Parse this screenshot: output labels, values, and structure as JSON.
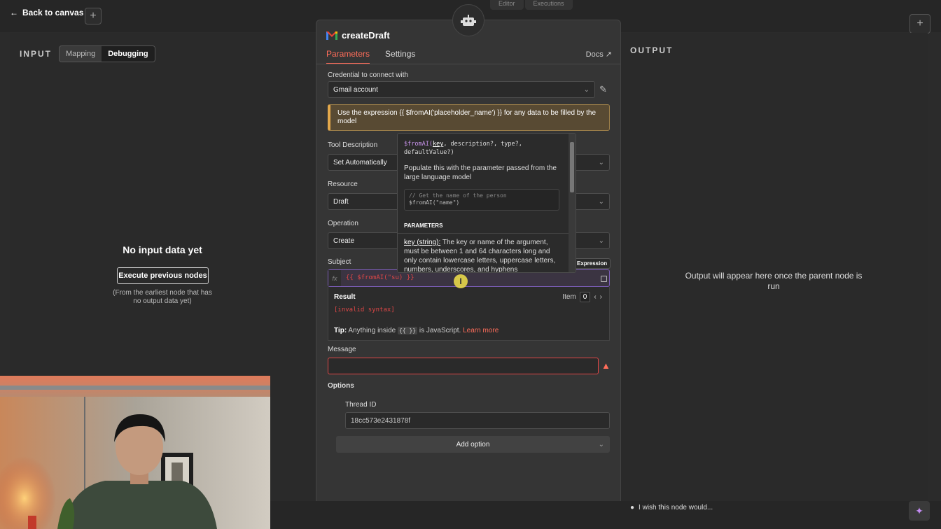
{
  "topbar": {
    "back_label": "Back to canvas",
    "tabs": [
      "Editor",
      "Executions"
    ]
  },
  "input": {
    "title": "INPUT",
    "modes": [
      "Mapping",
      "Debugging"
    ],
    "active_mode": "Debugging",
    "empty_title": "No input data yet",
    "execute_button": "Execute previous nodes",
    "note_line1": "(From the earliest node that has",
    "note_line2": "no output data yet)"
  },
  "output": {
    "title": "OUTPUT",
    "message": "Output will appear here once the parent node is run"
  },
  "node": {
    "title": "createDraft",
    "tabs": [
      "Parameters",
      "Settings"
    ],
    "active_tab": "Parameters",
    "docs_label": "Docs",
    "credential_label": "Credential to connect with",
    "credential_value": "Gmail account",
    "notice": "Use the expression {{ $fromAI('placeholder_name') }} for any data to be filled by the model",
    "tool_description_label": "Tool Description",
    "tool_description_value": "Set Automatically",
    "resource_label": "Resource",
    "resource_value": "Draft",
    "operation_label": "Operation",
    "operation_value": "Create",
    "subject_label": "Subject",
    "subject_badge": "Expression",
    "subject_expression": "{{ $fromAI(\"su) }}",
    "result_label": "Result",
    "result_value": "[invalid syntax]",
    "item_label": "Item",
    "item_index": "0",
    "tip_label": "Tip:",
    "tip_text_before": "Anything inside",
    "tip_code": "{{ }}",
    "tip_text_after": "is JavaScript.",
    "tip_link": "Learn more",
    "message_label": "Message",
    "message_value": "",
    "options_label": "Options",
    "thread_label": "Thread ID",
    "thread_value": "18cc573e2431878f",
    "add_option": "Add option"
  },
  "popup": {
    "signature_fn": "$fromAI(",
    "signature_key": "key",
    "signature_rest": ", description?, type?, defaultValue?)",
    "description": "Populate this with the parameter passed from the large language model",
    "code_comment": "// Get the name of the person",
    "code_line": "$fromAI(\"name\")",
    "params_heading": "PARAMETERS",
    "key_name": "key (string):",
    "key_desc": "The key or name of the argument, must be between 1 and 64 characters long and only contain lowercase letters, uppercase letters, numbers, underscores, and hyphens"
  },
  "bottom": {
    "wish": "I wish this node would..."
  },
  "colors": {
    "accent": "#ff6d5a",
    "error": "#e04747",
    "expression_border": "#7a5cb5",
    "notice_bg": "#584a33"
  }
}
